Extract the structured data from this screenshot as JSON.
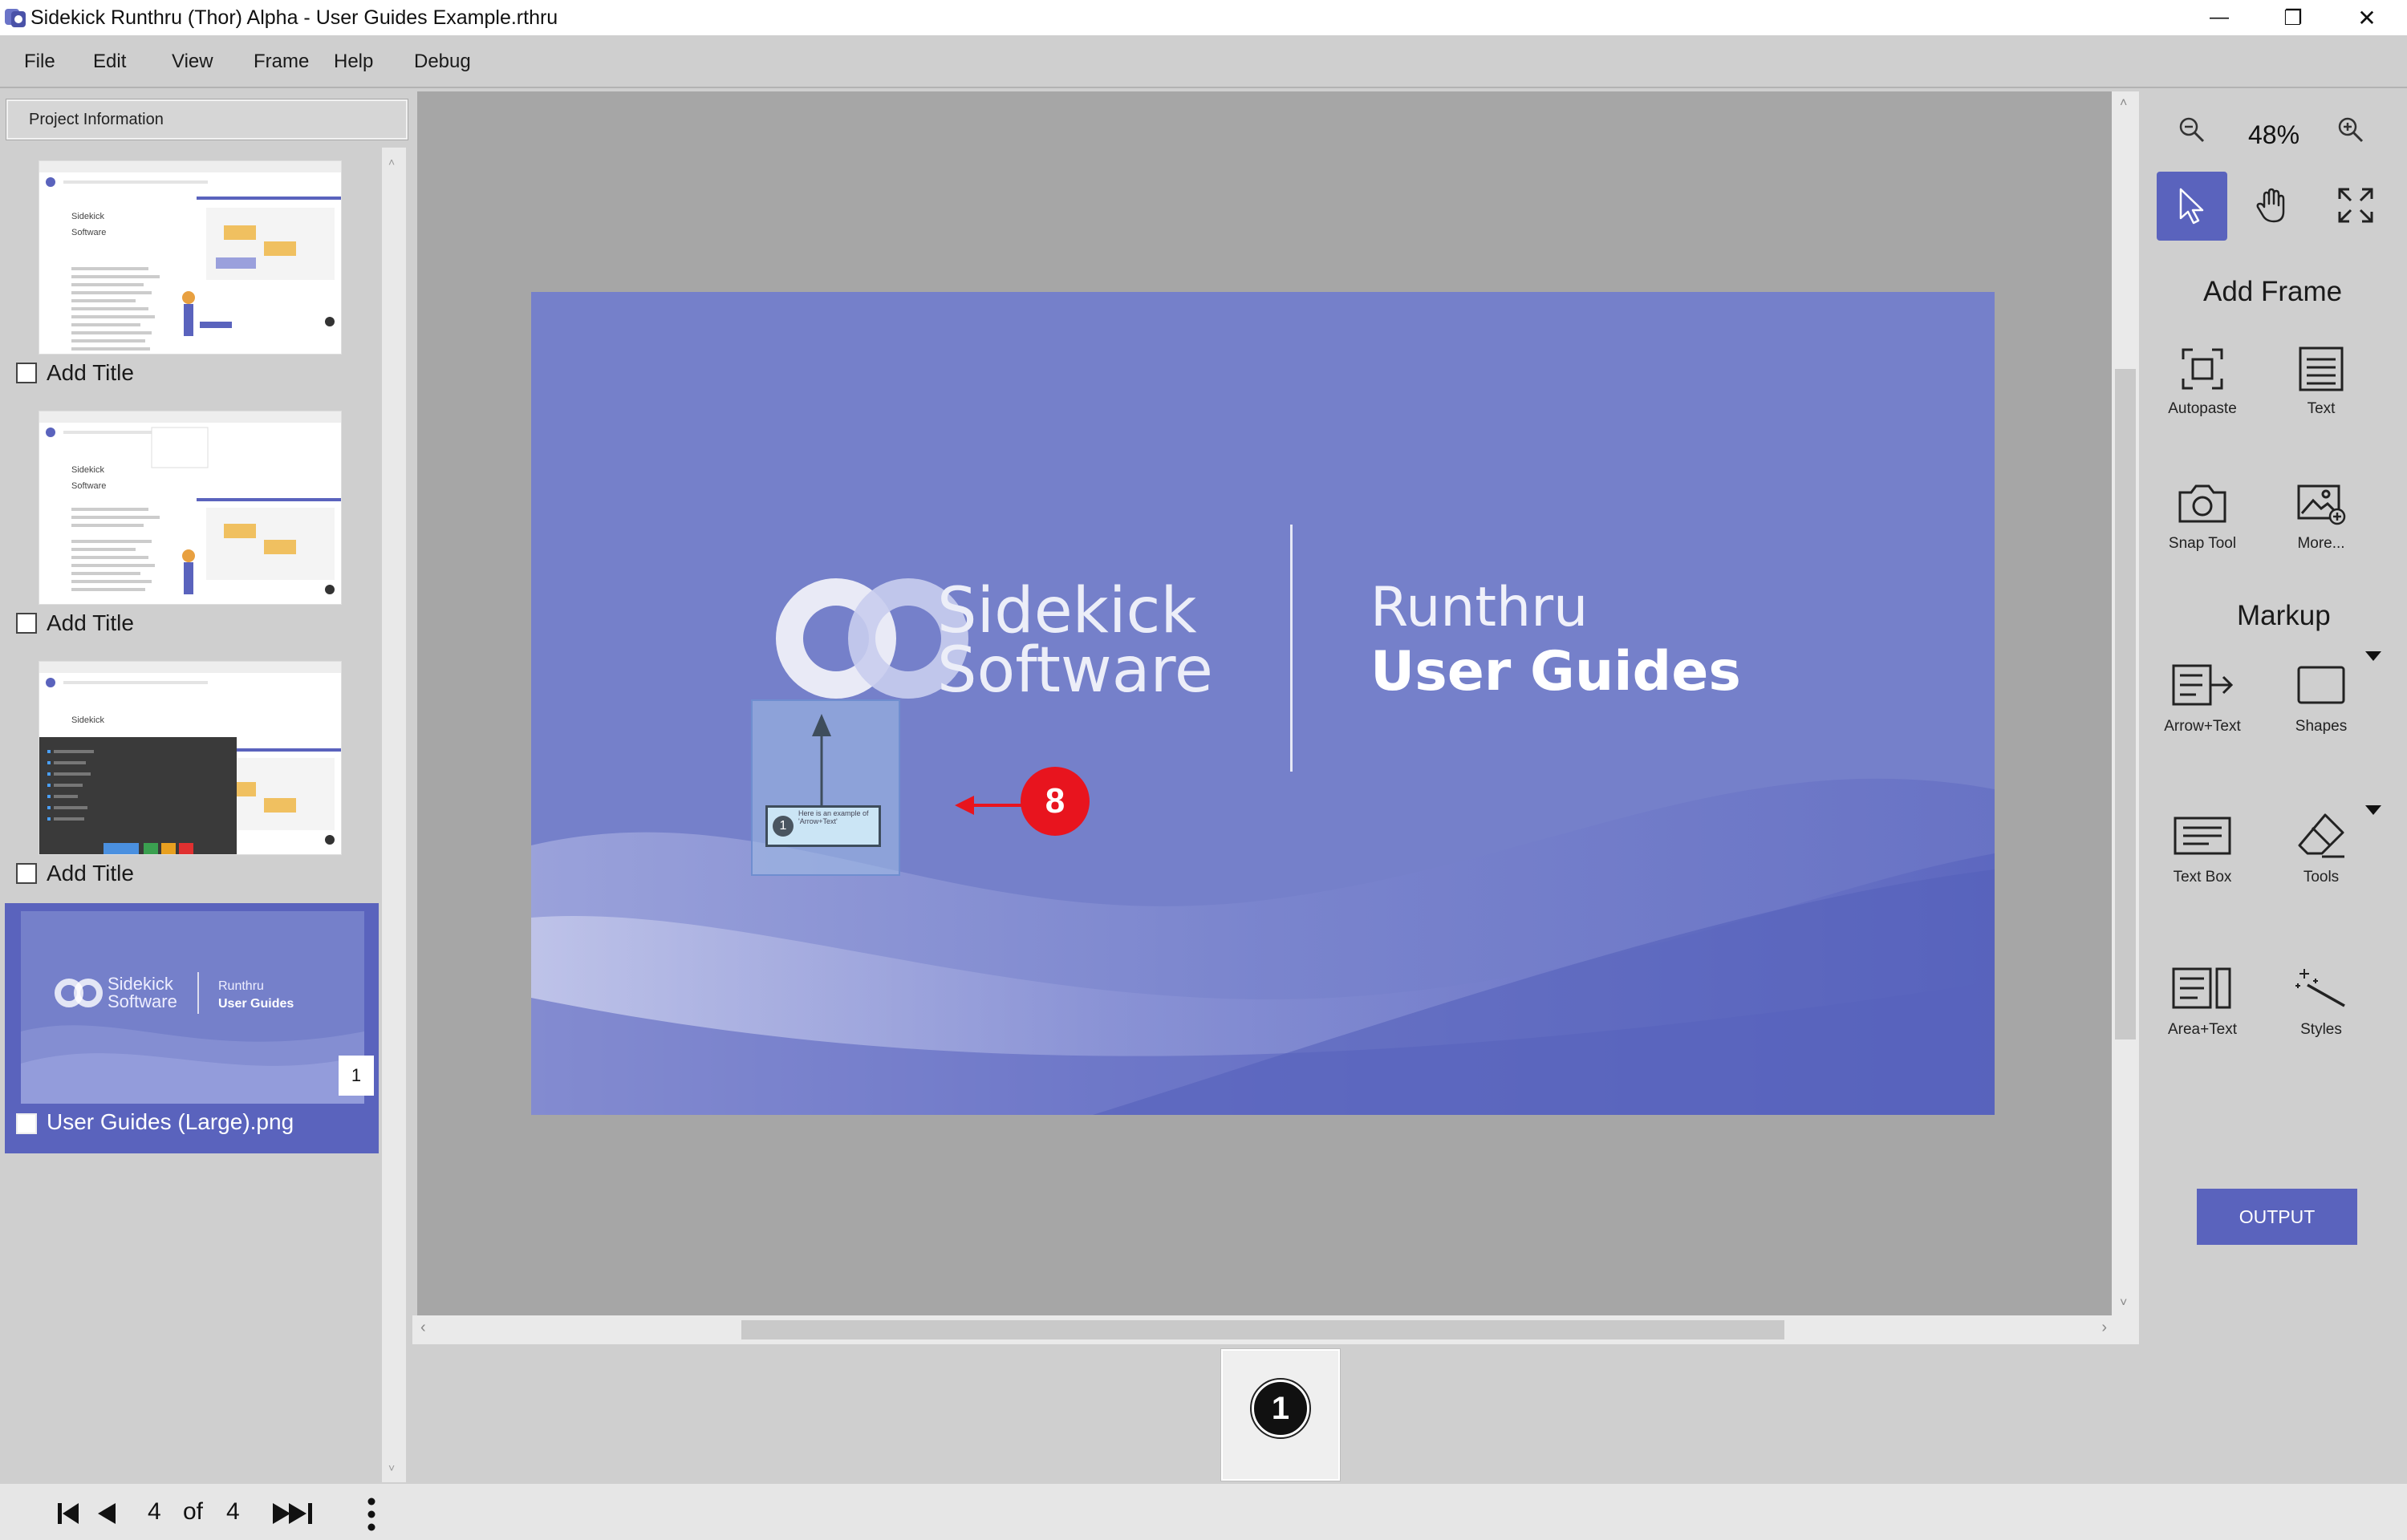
{
  "window": {
    "title": "Sidekick Runthru (Thor) Alpha - User Guides Example.rthru",
    "minimize_glyph": "—",
    "restore_glyph": "❐",
    "close_glyph": "✕"
  },
  "menu": [
    "File",
    "Edit",
    "View",
    "Frame",
    "Help",
    "Debug"
  ],
  "left_panel": {
    "project_info_label": "Project Information",
    "items": [
      {
        "label": "Add Title",
        "checked": false
      },
      {
        "label": "Add Title",
        "checked": false
      },
      {
        "label": "Add Title",
        "checked": false
      },
      {
        "label": "User Guides (Large).png",
        "checked": false,
        "selected": true,
        "badge": "1"
      }
    ],
    "thumb_text": {
      "brand_line1": "Sidekick",
      "brand_line2": "Software",
      "mini_brand1": "Sidekick",
      "mini_brand2": "Software",
      "mini_title1": "Runthru",
      "mini_title2": "User Guides"
    }
  },
  "slide": {
    "brand_line1": "Sidekick",
    "brand_line2": "Software",
    "title_line1": "Runthru",
    "title_line2": "User Guides",
    "callout_number": "1",
    "callout_text": "Here is an example of 'Arrow+Text'",
    "marker_number": "8"
  },
  "frame_strip": {
    "frame_number": "1"
  },
  "navigation": {
    "current": "4",
    "of_label": "of",
    "total": "4"
  },
  "right_panel": {
    "zoom_level": "48%",
    "add_frame_title": "Add Frame",
    "markup_title": "Markup",
    "tools": {
      "autopaste": "Autopaste",
      "text": "Text",
      "snap_tool": "Snap Tool",
      "more": "More...",
      "arrow_text": "Arrow+Text",
      "shapes": "Shapes",
      "text_box": "Text Box",
      "tools": "Tools",
      "area_text": "Area+Text",
      "styles": "Styles"
    },
    "output_label": "OUTPUT"
  },
  "colors": {
    "accent": "#5a63bd",
    "slide_bg": "#7580ca",
    "marker_red": "#e8141e"
  }
}
